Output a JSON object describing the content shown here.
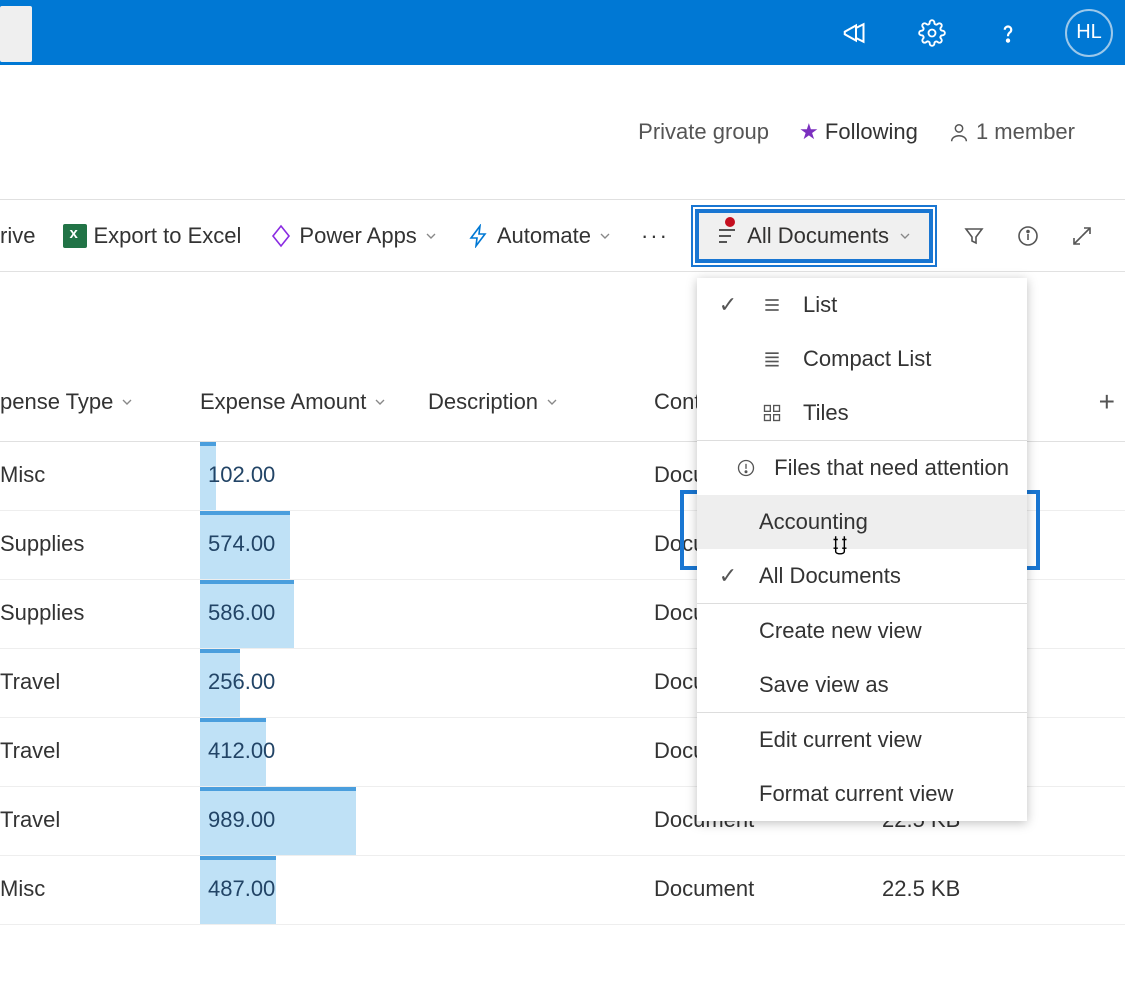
{
  "header": {
    "avatar_initials": "HL"
  },
  "subheader": {
    "group_privacy": "Private group",
    "following_label": "Following",
    "member_count": "1 member"
  },
  "cmdbar": {
    "drive_tail": "rive",
    "export_label": "Export to Excel",
    "powerapps_label": "Power Apps",
    "automate_label": "Automate",
    "view_selected": "All Documents"
  },
  "columns": {
    "type": "pense Type",
    "amount": "Expense Amount",
    "description": "Description",
    "content": "Cont",
    "add": "+"
  },
  "rows": [
    {
      "type": "Misc",
      "amount": "102.00",
      "fill_pct": 8,
      "content": "Docu",
      "size": ""
    },
    {
      "type": "Supplies",
      "amount": "574.00",
      "fill_pct": 45,
      "content": "Docu",
      "size": ""
    },
    {
      "type": "Supplies",
      "amount": "586.00",
      "fill_pct": 47,
      "content": "Docu",
      "size": ""
    },
    {
      "type": "Travel",
      "amount": "256.00",
      "fill_pct": 20,
      "content": "Docu",
      "size": ""
    },
    {
      "type": "Travel",
      "amount": "412.00",
      "fill_pct": 33,
      "content": "Docu",
      "size": ""
    },
    {
      "type": "Travel",
      "amount": "989.00",
      "fill_pct": 78,
      "content": "Document",
      "size": "22.5 KB"
    },
    {
      "type": "Misc",
      "amount": "487.00",
      "fill_pct": 38,
      "content": "Document",
      "size": "22.5 KB"
    }
  ],
  "dropdown": {
    "list": "List",
    "compact": "Compact List",
    "tiles": "Tiles",
    "attention": "Files that need attention",
    "accounting": "Accounting",
    "all_docs": "All Documents",
    "create_view": "Create new view",
    "save_as": "Save view as",
    "edit_view": "Edit current view",
    "format_view": "Format current view"
  }
}
